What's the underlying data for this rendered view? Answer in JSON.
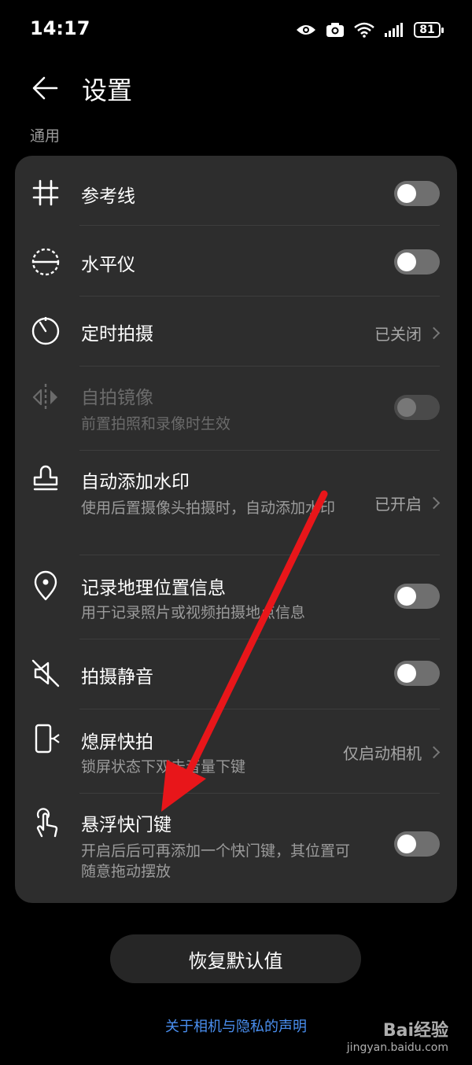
{
  "status": {
    "time": "14:17",
    "battery": "81"
  },
  "header": {
    "title": "设置",
    "section": "通用"
  },
  "rows": [
    {
      "icon": "grid-lines-icon",
      "title": "参考线"
    },
    {
      "icon": "level-icon",
      "title": "水平仪"
    },
    {
      "icon": "timer-icon",
      "title": "定时拍摄",
      "value": "已关闭"
    },
    {
      "icon": "mirror-icon",
      "title": "自拍镜像",
      "subtitle": "前置拍照和录像时生效"
    },
    {
      "icon": "stamp-icon",
      "title": "自动添加水印",
      "subtitle": "使用后置摄像头拍摄时，自动添加水印",
      "value": "已开启"
    },
    {
      "icon": "location-icon",
      "title": "记录地理位置信息",
      "subtitle": "用于记录照片或视频拍摄地点信息"
    },
    {
      "icon": "mute-icon",
      "title": "拍摄静音"
    },
    {
      "icon": "screen-off-snap-icon",
      "title": "熄屏快拍",
      "subtitle": "锁屏状态下双击音量下键",
      "value": "仅启动相机"
    },
    {
      "icon": "touch-shutter-icon",
      "title": "悬浮快门键",
      "subtitle": "开启后后可再添加一个快门键，其位置可随意拖动摆放"
    }
  ],
  "footer": {
    "reset": "恢复默认值",
    "privacy": "关于相机与隐私的声明"
  },
  "watermark": {
    "brand": "Bai经验",
    "url": "jingyan.baidu.com"
  },
  "colors": {
    "background": "#000000",
    "card": "#2d2d2d",
    "link": "#4a8ff0",
    "arrow": "#e8161a"
  }
}
